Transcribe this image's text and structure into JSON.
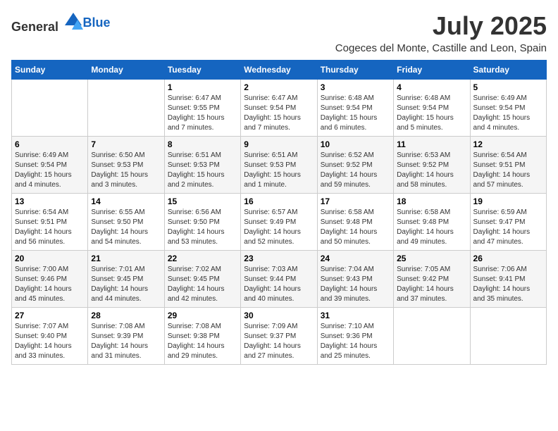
{
  "logo": {
    "general": "General",
    "blue": "Blue"
  },
  "title": "July 2025",
  "location": "Cogeces del Monte, Castille and Leon, Spain",
  "days_of_week": [
    "Sunday",
    "Monday",
    "Tuesday",
    "Wednesday",
    "Thursday",
    "Friday",
    "Saturday"
  ],
  "weeks": [
    [
      {
        "day": "",
        "info": ""
      },
      {
        "day": "",
        "info": ""
      },
      {
        "day": "1",
        "info": "Sunrise: 6:47 AM\nSunset: 9:55 PM\nDaylight: 15 hours and 7 minutes."
      },
      {
        "day": "2",
        "info": "Sunrise: 6:47 AM\nSunset: 9:54 PM\nDaylight: 15 hours and 7 minutes."
      },
      {
        "day": "3",
        "info": "Sunrise: 6:48 AM\nSunset: 9:54 PM\nDaylight: 15 hours and 6 minutes."
      },
      {
        "day": "4",
        "info": "Sunrise: 6:48 AM\nSunset: 9:54 PM\nDaylight: 15 hours and 5 minutes."
      },
      {
        "day": "5",
        "info": "Sunrise: 6:49 AM\nSunset: 9:54 PM\nDaylight: 15 hours and 4 minutes."
      }
    ],
    [
      {
        "day": "6",
        "info": "Sunrise: 6:49 AM\nSunset: 9:54 PM\nDaylight: 15 hours and 4 minutes."
      },
      {
        "day": "7",
        "info": "Sunrise: 6:50 AM\nSunset: 9:53 PM\nDaylight: 15 hours and 3 minutes."
      },
      {
        "day": "8",
        "info": "Sunrise: 6:51 AM\nSunset: 9:53 PM\nDaylight: 15 hours and 2 minutes."
      },
      {
        "day": "9",
        "info": "Sunrise: 6:51 AM\nSunset: 9:53 PM\nDaylight: 15 hours and 1 minute."
      },
      {
        "day": "10",
        "info": "Sunrise: 6:52 AM\nSunset: 9:52 PM\nDaylight: 14 hours and 59 minutes."
      },
      {
        "day": "11",
        "info": "Sunrise: 6:53 AM\nSunset: 9:52 PM\nDaylight: 14 hours and 58 minutes."
      },
      {
        "day": "12",
        "info": "Sunrise: 6:54 AM\nSunset: 9:51 PM\nDaylight: 14 hours and 57 minutes."
      }
    ],
    [
      {
        "day": "13",
        "info": "Sunrise: 6:54 AM\nSunset: 9:51 PM\nDaylight: 14 hours and 56 minutes."
      },
      {
        "day": "14",
        "info": "Sunrise: 6:55 AM\nSunset: 9:50 PM\nDaylight: 14 hours and 54 minutes."
      },
      {
        "day": "15",
        "info": "Sunrise: 6:56 AM\nSunset: 9:50 PM\nDaylight: 14 hours and 53 minutes."
      },
      {
        "day": "16",
        "info": "Sunrise: 6:57 AM\nSunset: 9:49 PM\nDaylight: 14 hours and 52 minutes."
      },
      {
        "day": "17",
        "info": "Sunrise: 6:58 AM\nSunset: 9:48 PM\nDaylight: 14 hours and 50 minutes."
      },
      {
        "day": "18",
        "info": "Sunrise: 6:58 AM\nSunset: 9:48 PM\nDaylight: 14 hours and 49 minutes."
      },
      {
        "day": "19",
        "info": "Sunrise: 6:59 AM\nSunset: 9:47 PM\nDaylight: 14 hours and 47 minutes."
      }
    ],
    [
      {
        "day": "20",
        "info": "Sunrise: 7:00 AM\nSunset: 9:46 PM\nDaylight: 14 hours and 45 minutes."
      },
      {
        "day": "21",
        "info": "Sunrise: 7:01 AM\nSunset: 9:45 PM\nDaylight: 14 hours and 44 minutes."
      },
      {
        "day": "22",
        "info": "Sunrise: 7:02 AM\nSunset: 9:45 PM\nDaylight: 14 hours and 42 minutes."
      },
      {
        "day": "23",
        "info": "Sunrise: 7:03 AM\nSunset: 9:44 PM\nDaylight: 14 hours and 40 minutes."
      },
      {
        "day": "24",
        "info": "Sunrise: 7:04 AM\nSunset: 9:43 PM\nDaylight: 14 hours and 39 minutes."
      },
      {
        "day": "25",
        "info": "Sunrise: 7:05 AM\nSunset: 9:42 PM\nDaylight: 14 hours and 37 minutes."
      },
      {
        "day": "26",
        "info": "Sunrise: 7:06 AM\nSunset: 9:41 PM\nDaylight: 14 hours and 35 minutes."
      }
    ],
    [
      {
        "day": "27",
        "info": "Sunrise: 7:07 AM\nSunset: 9:40 PM\nDaylight: 14 hours and 33 minutes."
      },
      {
        "day": "28",
        "info": "Sunrise: 7:08 AM\nSunset: 9:39 PM\nDaylight: 14 hours and 31 minutes."
      },
      {
        "day": "29",
        "info": "Sunrise: 7:08 AM\nSunset: 9:38 PM\nDaylight: 14 hours and 29 minutes."
      },
      {
        "day": "30",
        "info": "Sunrise: 7:09 AM\nSunset: 9:37 PM\nDaylight: 14 hours and 27 minutes."
      },
      {
        "day": "31",
        "info": "Sunrise: 7:10 AM\nSunset: 9:36 PM\nDaylight: 14 hours and 25 minutes."
      },
      {
        "day": "",
        "info": ""
      },
      {
        "day": "",
        "info": ""
      }
    ]
  ]
}
